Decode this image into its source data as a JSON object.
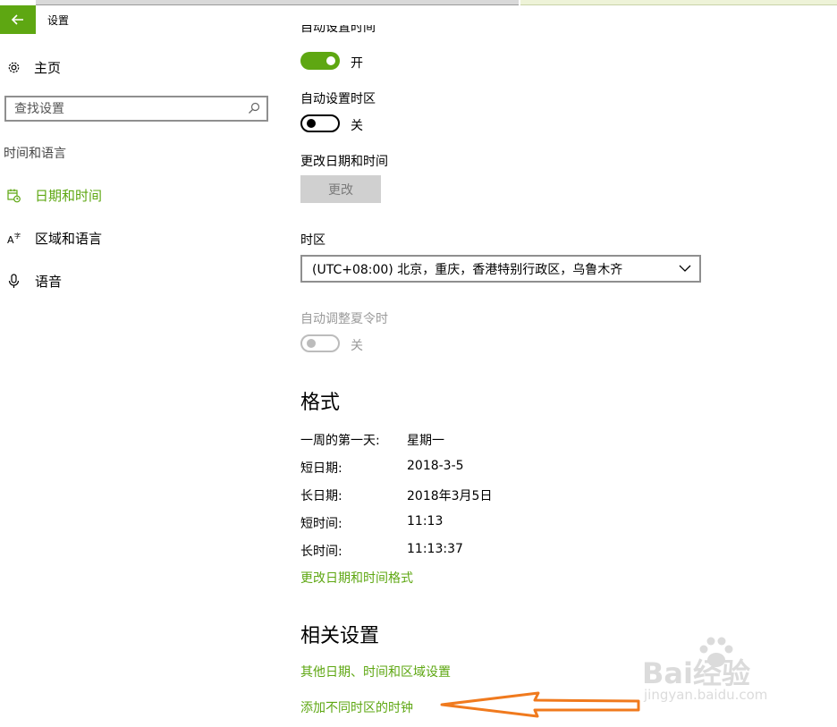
{
  "window": {
    "title": "设置"
  },
  "sidebar": {
    "home_label": "主页",
    "search_placeholder": "查找设置",
    "section_label": "时间和语言",
    "items": [
      {
        "label": "日期和时间",
        "icon": "calendar-clock-icon",
        "active": true
      },
      {
        "label": "区域和语言",
        "icon": "language-icon",
        "active": false
      },
      {
        "label": "语音",
        "icon": "microphone-icon",
        "active": false
      }
    ]
  },
  "main": {
    "auto_time": {
      "label": "自动设置时间",
      "state_label": "开",
      "on": true
    },
    "auto_timezone": {
      "label": "自动设置时区",
      "state_label": "关",
      "on": false
    },
    "change_datetime": {
      "label": "更改日期和时间",
      "button_label": "更改"
    },
    "timezone": {
      "label": "时区",
      "value": "(UTC+08:00) 北京，重庆，香港特别行政区，乌鲁木齐"
    },
    "dst": {
      "label": "自动调整夏令时",
      "state_label": "关",
      "enabled": false
    },
    "formats": {
      "heading": "格式",
      "rows": [
        {
          "key": "一周的第一天:",
          "value": "星期一"
        },
        {
          "key": "短日期:",
          "value": "2018-3-5"
        },
        {
          "key": "长日期:",
          "value": "2018年3月5日"
        },
        {
          "key": "短时间:",
          "value": "11:13"
        },
        {
          "key": "长时间:",
          "value": "11:13:37"
        }
      ],
      "link": "更改日期和时间格式"
    },
    "related": {
      "heading": "相关设置",
      "links": [
        "其他日期、时间和区域设置",
        "添加不同时区的时钟"
      ]
    }
  },
  "watermark": {
    "brand": "Bai经验",
    "url": "jingyan.baidu.com"
  },
  "colors": {
    "accent": "#5ea712",
    "arrow": "#f07a1e",
    "button_gray": "#d0d0d0"
  }
}
